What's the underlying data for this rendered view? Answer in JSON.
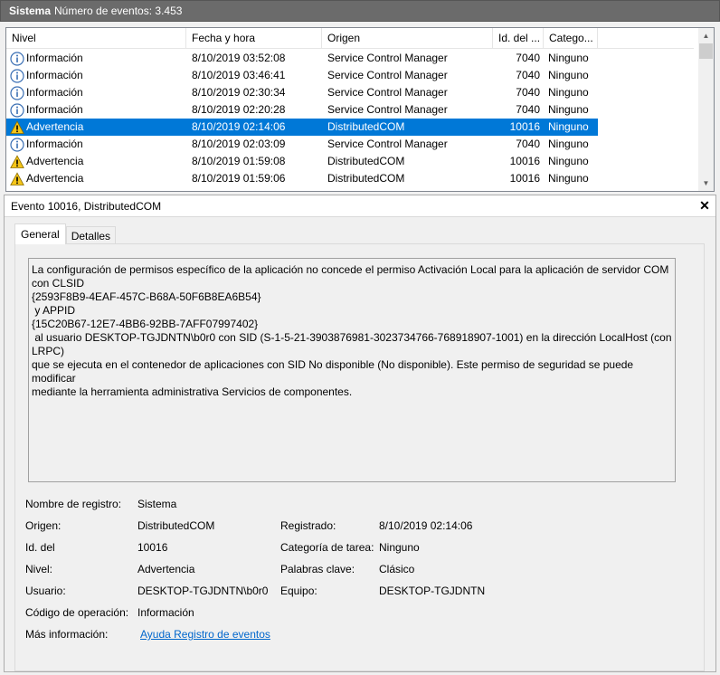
{
  "header": {
    "title": "Sistema",
    "event_count": "Número de eventos: 3.453"
  },
  "list": {
    "columns": [
      "Nivel",
      "Fecha y hora",
      "Origen",
      "Id. del ...",
      "Catego..."
    ],
    "rows": [
      {
        "level": "Información",
        "icon": "info-icon",
        "date": "8/10/2019 03:52:08",
        "source": "Service Control Manager",
        "id": "7040",
        "category": "Ninguno",
        "selected": false
      },
      {
        "level": "Información",
        "icon": "info-icon",
        "date": "8/10/2019 03:46:41",
        "source": "Service Control Manager",
        "id": "7040",
        "category": "Ninguno",
        "selected": false
      },
      {
        "level": "Información",
        "icon": "info-icon",
        "date": "8/10/2019 02:30:34",
        "source": "Service Control Manager",
        "id": "7040",
        "category": "Ninguno",
        "selected": false
      },
      {
        "level": "Información",
        "icon": "info-icon",
        "date": "8/10/2019 02:20:28",
        "source": "Service Control Manager",
        "id": "7040",
        "category": "Ninguno",
        "selected": false
      },
      {
        "level": "Advertencia",
        "icon": "warning-icon",
        "date": "8/10/2019 02:14:06",
        "source": "DistributedCOM",
        "id": "10016",
        "category": "Ninguno",
        "selected": true
      },
      {
        "level": "Información",
        "icon": "info-icon",
        "date": "8/10/2019 02:03:09",
        "source": "Service Control Manager",
        "id": "7040",
        "category": "Ninguno",
        "selected": false
      },
      {
        "level": "Advertencia",
        "icon": "warning-icon",
        "date": "8/10/2019 01:59:08",
        "source": "DistributedCOM",
        "id": "10016",
        "category": "Ninguno",
        "selected": false
      },
      {
        "level": "Advertencia",
        "icon": "warning-icon",
        "date": "8/10/2019 01:59:06",
        "source": "DistributedCOM",
        "id": "10016",
        "category": "Ninguno",
        "selected": false
      }
    ]
  },
  "detail": {
    "title": "Evento 10016, DistributedCOM",
    "close_label": "✕",
    "tabs": [
      "General",
      "Detalles"
    ],
    "description": "La configuración de permisos específico de la aplicación no concede el permiso Activación Local para la aplicación de servidor COM\ncon CLSID\n{2593F8B9-4EAF-457C-B68A-50F6B8EA6B54}\n y APPID\n{15C20B67-12E7-4BB6-92BB-7AFF07997402}\n al usuario DESKTOP-TGJDNTN\\b0r0 con SID (S-1-5-21-3903876981-3023734766-768918907-1001) en la dirección LocalHost (con LRPC)\nque se ejecuta en el contenedor de aplicaciones con SID No disponible (No disponible). Este permiso de seguridad se puede modificar\nmediante la herramienta administrativa Servicios de componentes.",
    "props": {
      "log_name_label": "Nombre de registro:",
      "log_name": "Sistema",
      "source_label": "Origen:",
      "source": "DistributedCOM",
      "logged_label": "Registrado:",
      "logged": "8/10/2019 02:14:06",
      "event_id_label": "Id. del",
      "event_id": "10016",
      "task_label": "Categoría de tarea:",
      "task": "Ninguno",
      "level_label": "Nivel:",
      "level": "Advertencia",
      "keywords_label": "Palabras clave:",
      "keywords": "Clásico",
      "user_label": "Usuario:",
      "user": "DESKTOP-TGJDNTN\\b0r0",
      "computer_label": "Equipo:",
      "computer": "DESKTOP-TGJDNTN",
      "opcode_label": "Código de operación:",
      "opcode": "Información",
      "more_info_label": "Más información:",
      "more_info_link": "Ayuda Registro de eventos"
    }
  },
  "colors": {
    "selection": "#0078d7",
    "header_bar": "#6b6b6b",
    "info_icon": "#3a6fb4",
    "warning_icon": "#f5c518",
    "link": "#0066cc"
  }
}
